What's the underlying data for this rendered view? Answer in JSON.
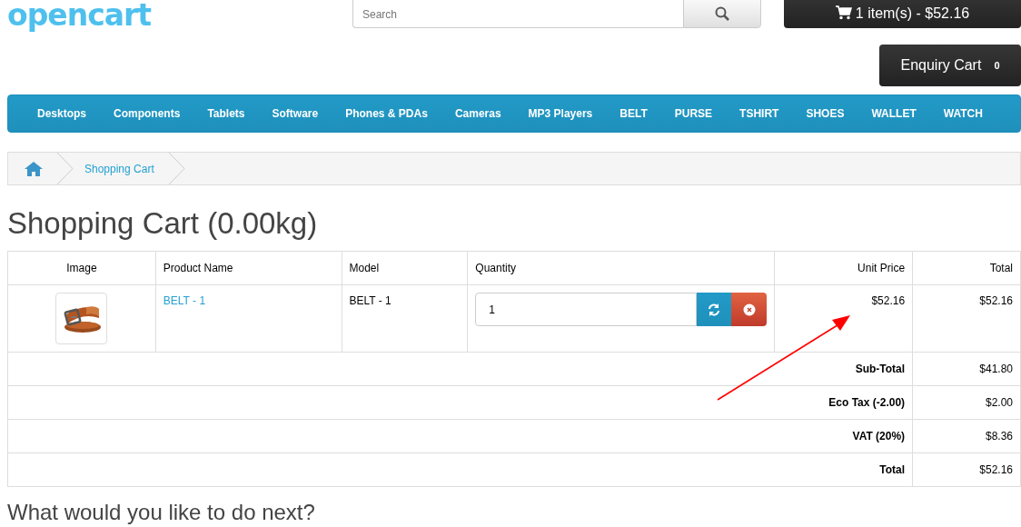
{
  "logo": "opencart",
  "search": {
    "placeholder": "Search"
  },
  "cart_button": "1 item(s) - $52.16",
  "enquiry_cart": {
    "label": "Enquiry Cart",
    "count": "0"
  },
  "menu": [
    "Desktops",
    "Components",
    "Tablets",
    "Software",
    "Phones & PDAs",
    "Cameras",
    "MP3 Players",
    "BELT",
    "PURSE",
    "TSHIRT",
    "SHOES",
    "WALLET",
    "WATCH"
  ],
  "breadcrumb": [
    "Shopping Cart"
  ],
  "title": "Shopping Cart (0.00kg)",
  "table": {
    "columns": [
      "Image",
      "Product Name",
      "Model",
      "Quantity",
      "Unit Price",
      "Total"
    ],
    "rows": [
      {
        "name": "BELT - 1",
        "model": "BELT - 1",
        "quantity": "1",
        "unit_price": "$52.16",
        "total": "$52.16"
      }
    ]
  },
  "totals": [
    {
      "label": "Sub-Total",
      "value": "$41.80"
    },
    {
      "label": "Eco Tax (-2.00)",
      "value": "$2.00"
    },
    {
      "label": "VAT (20%)",
      "value": "$8.36"
    },
    {
      "label": "Total",
      "value": "$52.16"
    }
  ],
  "next_heading": "What would you like to do next?"
}
